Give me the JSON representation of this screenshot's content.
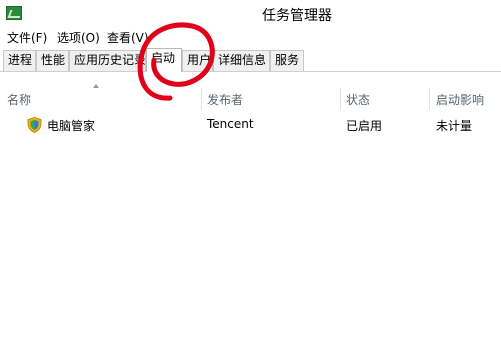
{
  "window": {
    "title": "任务管理器"
  },
  "menu": {
    "items": [
      "文件(F)",
      "选项(O)",
      "查看(V)"
    ]
  },
  "tabs": {
    "items": [
      "进程",
      "性能",
      "应用历史记录",
      "启动",
      "用户",
      "详细信息",
      "服务"
    ],
    "active": "启动"
  },
  "columns": {
    "name": "名称",
    "publisher": "发布者",
    "status": "状态",
    "impact": "启动影响"
  },
  "rows": [
    {
      "name": "电脑管家",
      "publisher": "Tencent",
      "status": "已启用",
      "impact": "未计量",
      "icon": "shield-icon"
    }
  ],
  "annotation": {
    "color": "#e0001a"
  }
}
